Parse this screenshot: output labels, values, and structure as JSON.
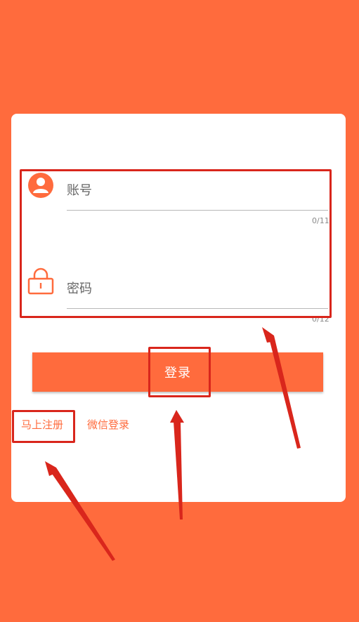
{
  "colors": {
    "primary": "#ff6b3d",
    "card": "#ffffff",
    "annotation": "#d9261c"
  },
  "form": {
    "account": {
      "placeholder": "账号",
      "counter": "0/11",
      "icon": "user-icon"
    },
    "password": {
      "placeholder": "密码",
      "counter": "0/12",
      "icon": "lock-icon"
    },
    "login_label": "登录",
    "register_label": "马上注册",
    "wechat_login_label": "微信登录"
  }
}
